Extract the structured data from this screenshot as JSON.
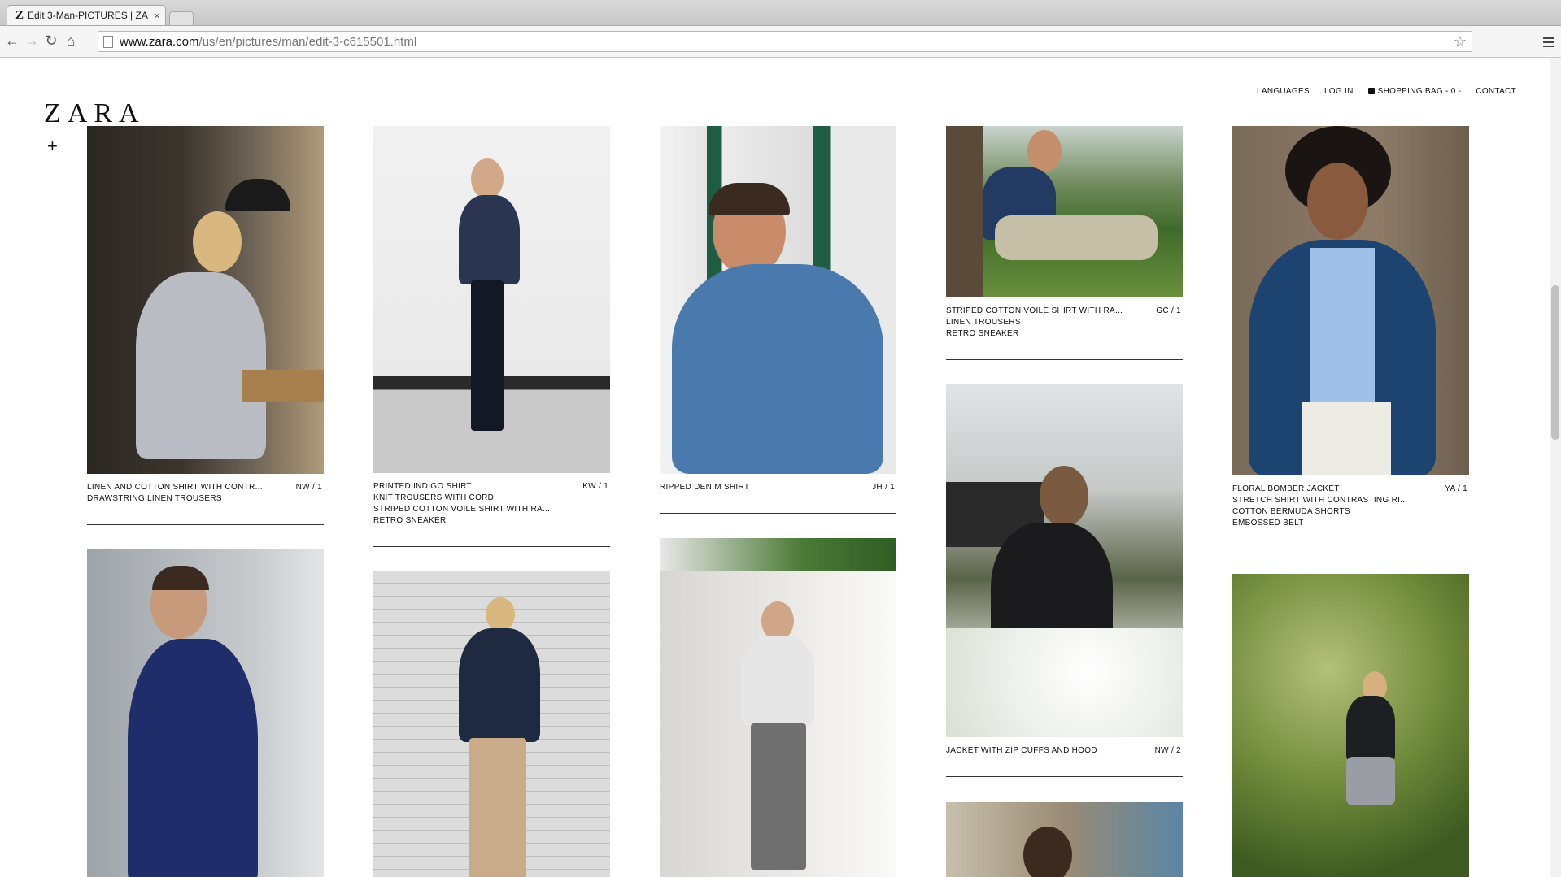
{
  "browser": {
    "tab_title": "Edit 3-Man-PICTURES | ZA",
    "tab_favicon": "Z",
    "url_host": "www.zara.com",
    "url_path": "/us/en/pictures/man/edit-3-c615501.html"
  },
  "header": {
    "logo": "ZARA",
    "plus": "+",
    "nav": {
      "languages": "LANGUAGES",
      "login": "LOG IN",
      "bag": "SHOPPING BAG - 0 -",
      "contact": "CONTACT"
    }
  },
  "cards": [
    {
      "code": "NW / 1",
      "items": [
        "LINEN AND COTTON SHIRT WITH CONTR...",
        "DRAWSTRING LINEN TROUSERS"
      ]
    },
    {
      "code": "KW / 1",
      "items": [
        "PRINTED INDIGO SHIRT",
        "KNIT TROUSERS WITH CORD",
        "STRIPED COTTON VOILE SHIRT WITH RA...",
        "RETRO SNEAKER"
      ]
    },
    {
      "code": "JH / 1",
      "items": [
        "RIPPED DENIM SHIRT"
      ]
    },
    {
      "code": "GC / 1",
      "items": [
        "STRIPED COTTON VOILE SHIRT WITH RA...",
        "LINEN TROUSERS",
        "RETRO SNEAKER"
      ]
    },
    {
      "code": "YA / 1",
      "items": [
        "FLORAL BOMBER JACKET",
        "STRETCH SHIRT WITH CONTRASTING RI...",
        "COTTON BERMUDA SHORTS",
        "EMBOSSED BELT"
      ]
    },
    {
      "code": "NW / 2",
      "items": [
        "JACKET WITH ZIP CUFFS AND HOOD"
      ]
    }
  ]
}
